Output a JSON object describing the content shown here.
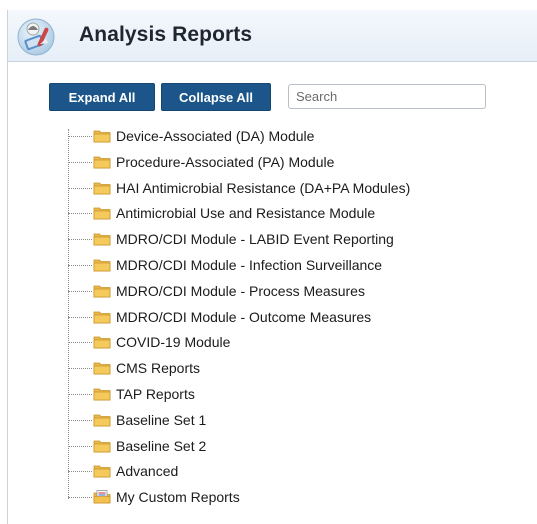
{
  "header": {
    "title": "Analysis Reports",
    "icon": "analysis-reports-icon"
  },
  "toolbar": {
    "expand_label": "Expand All",
    "collapse_label": "Collapse All",
    "search_placeholder": "Search",
    "search_value": ""
  },
  "tree": {
    "items": [
      {
        "label": "Device-Associated (DA) Module",
        "icon": "folder-icon"
      },
      {
        "label": "Procedure-Associated (PA) Module",
        "icon": "folder-icon"
      },
      {
        "label": "HAI Antimicrobial Resistance (DA+PA Modules)",
        "icon": "folder-icon"
      },
      {
        "label": "Antimicrobial Use and Resistance Module",
        "icon": "folder-icon"
      },
      {
        "label": "MDRO/CDI Module - LABID Event Reporting",
        "icon": "folder-icon"
      },
      {
        "label": "MDRO/CDI Module - Infection Surveillance",
        "icon": "folder-icon"
      },
      {
        "label": "MDRO/CDI Module - Process Measures",
        "icon": "folder-icon"
      },
      {
        "label": "MDRO/CDI Module - Outcome Measures",
        "icon": "folder-icon"
      },
      {
        "label": "COVID-19 Module",
        "icon": "folder-icon"
      },
      {
        "label": "CMS Reports",
        "icon": "folder-icon"
      },
      {
        "label": "TAP Reports",
        "icon": "folder-icon"
      },
      {
        "label": "Baseline Set 1",
        "icon": "folder-icon"
      },
      {
        "label": "Baseline Set 2",
        "icon": "folder-icon"
      },
      {
        "label": "Advanced",
        "icon": "folder-icon"
      },
      {
        "label": "My Custom Reports",
        "icon": "custom-reports-folder-icon"
      }
    ]
  },
  "colors": {
    "button_bg": "#1c5589",
    "folder": "#f2c14e",
    "header_bg": "#e6eef7"
  }
}
